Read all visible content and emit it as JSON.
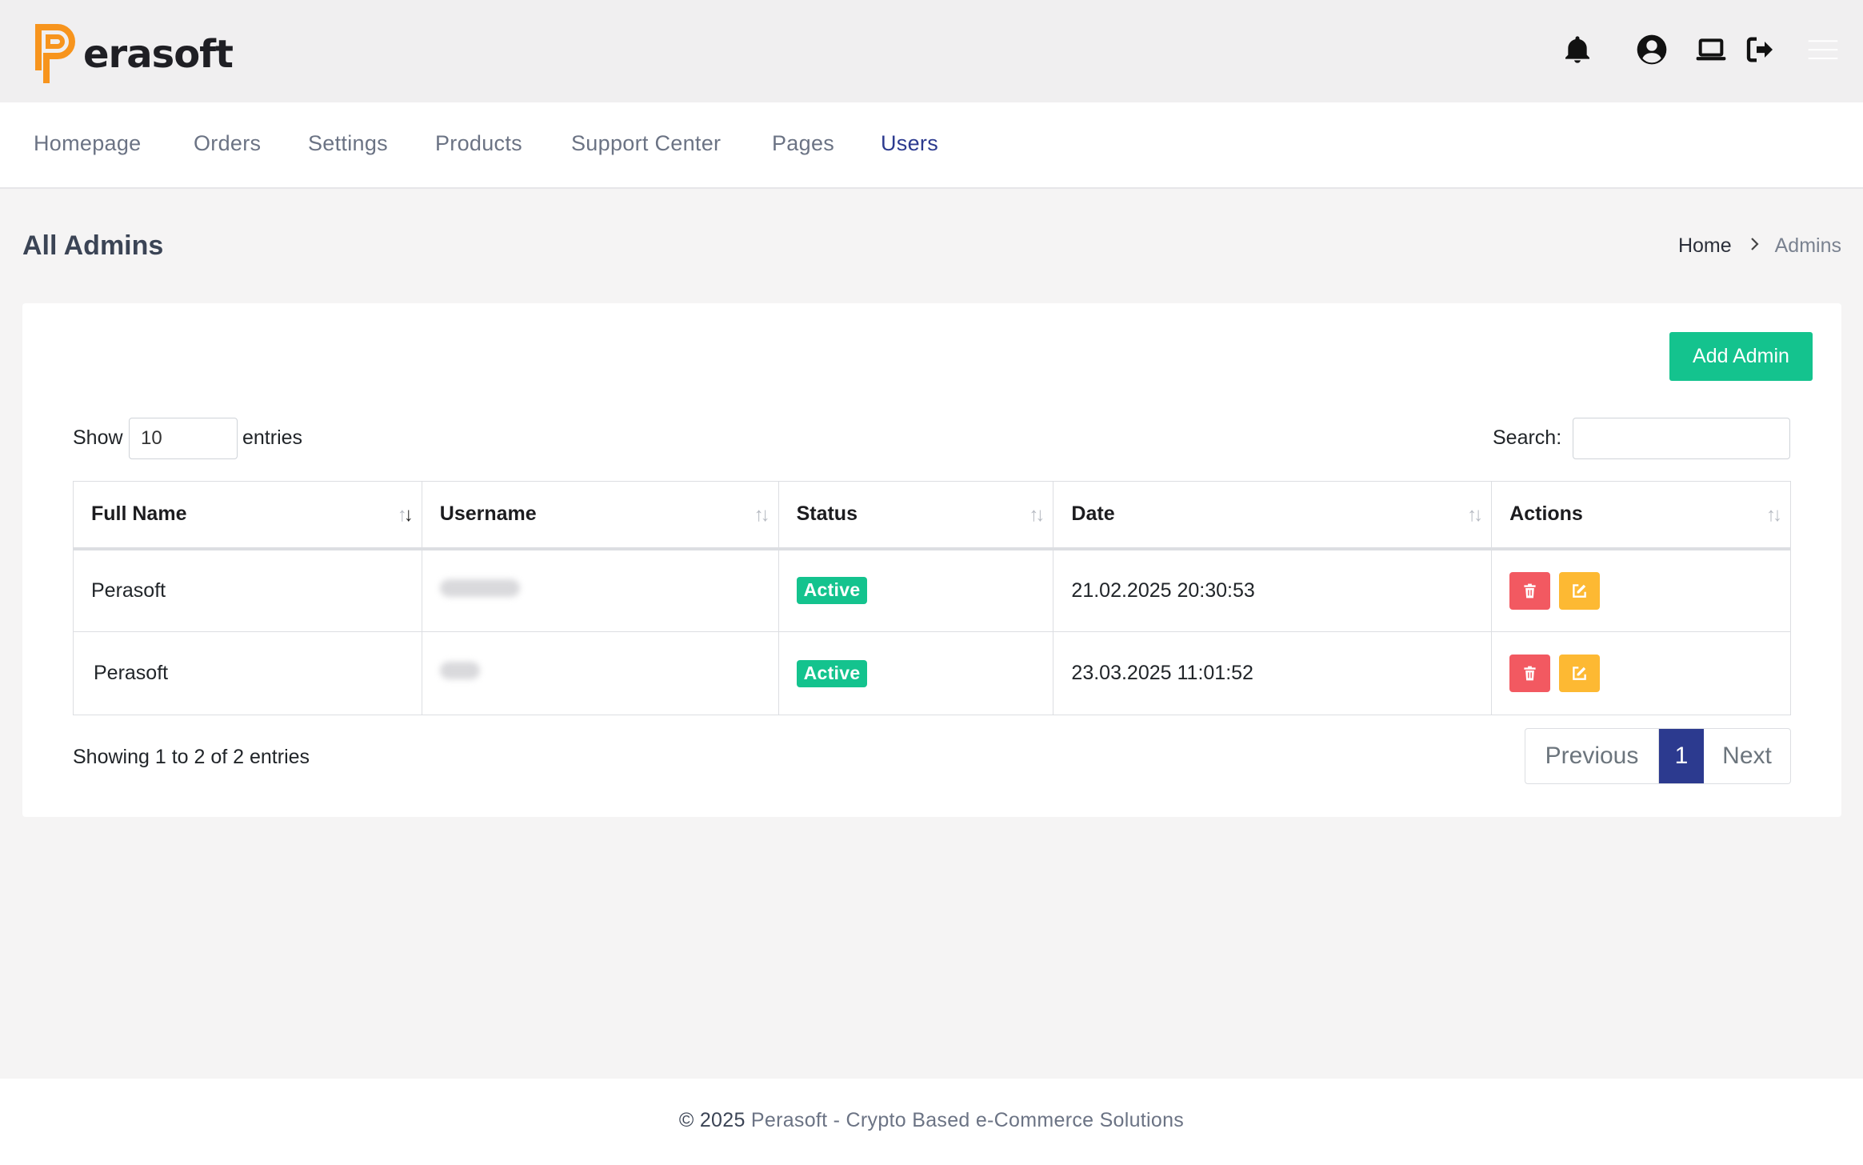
{
  "brand": {
    "name": "erasoft",
    "accent_color": "#f7941d",
    "text_color": "#1f1f24"
  },
  "header": {
    "icons": [
      "bell-icon",
      "user-circle-icon",
      "laptop-icon",
      "logout-icon",
      "hamburger-menu-icon"
    ]
  },
  "nav": {
    "items": [
      {
        "label": "Homepage",
        "active": false
      },
      {
        "label": "Orders",
        "active": false
      },
      {
        "label": "Settings",
        "active": false
      },
      {
        "label": "Products",
        "active": false
      },
      {
        "label": "Support Center",
        "active": false
      },
      {
        "label": "Pages",
        "active": false
      },
      {
        "label": "Users",
        "active": true
      }
    ],
    "active_color": "#2c3a8f"
  },
  "page": {
    "title": "All Admins",
    "breadcrumb": {
      "home": "Home",
      "current": "Admins"
    }
  },
  "card": {
    "add_button_label": "Add Admin",
    "add_button_color": "#14c38e",
    "show_label": "Show",
    "page_size": "10",
    "entries_label": "entries",
    "search_label": "Search:",
    "search_value": ""
  },
  "table": {
    "columns": [
      "Full Name",
      "Username",
      "Status",
      "Date",
      "Actions"
    ],
    "sorted_column": "Full Name",
    "rows": [
      {
        "full_name": "Perasoft",
        "username": "[blurred]",
        "status": "Active",
        "date": "21.02.2025 20:30:53"
      },
      {
        "full_name": "Perasoft",
        "username": "[blurred]",
        "status": "Active",
        "date": "23.03.2025 11:01:52"
      }
    ],
    "status_color": "#14c38e",
    "delete_color": "#f25961",
    "edit_color": "#fdb933"
  },
  "footer_table": {
    "info": "Showing 1 to 2 of 2 entries",
    "previous": "Previous",
    "current_page": "1",
    "next": "Next"
  },
  "footer": {
    "copyright": "© 2025",
    "text": "Perasoft - Crypto Based e-Commerce Solutions"
  }
}
